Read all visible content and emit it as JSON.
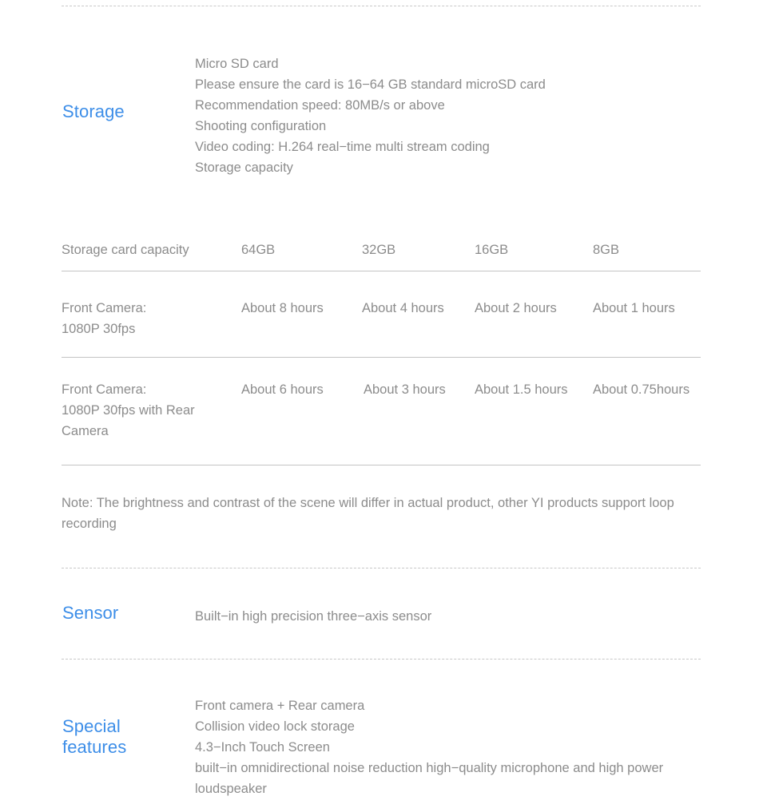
{
  "page": {
    "background": "#ffffff",
    "accent_color": "#3d8ee8",
    "text_color": "#8c8c8c"
  },
  "sections": {
    "storage": {
      "title": "Storage",
      "lines": [
        "Micro SD card",
        "Please ensure the card is 16−64 GB standard microSD card",
        "Recommendation speed: 80MB/s or above",
        "Shooting configuration",
        "Video coding: H.264 real−time multi stream coding",
        "Storage capacity"
      ]
    },
    "sensor": {
      "title": "Sensor",
      "lines": [
        "Built−in high precision three−axis sensor"
      ]
    },
    "special_features": {
      "title": "Special\nfeatures",
      "lines": [
        "Front camera + Rear camera",
        "Collision video lock storage",
        "4.3−Inch Touch Screen",
        "built−in omnidirectional noise reduction high−quality microphone and high power loudspeaker"
      ]
    }
  },
  "storage_table": {
    "header": {
      "label": "Storage card capacity",
      "columns": [
        "64GB",
        "32GB",
        "16GB",
        "8GB"
      ]
    },
    "rows": [
      {
        "label": "Front Camera:\n1080P 30fps",
        "values": [
          "About 8 hours",
          "About 4 hours",
          "About 2 hours",
          "About 1 hours"
        ]
      },
      {
        "label": "Front Camera:\n1080P 30fps with Rear\nCamera",
        "values": [
          "About 6 hours",
          "About 3 hours",
          "About 1.5 hours",
          "About 0.75hours"
        ]
      }
    ],
    "note": "Note: The brightness and contrast of the scene will differ in actual product, other YI products support loop recording"
  }
}
